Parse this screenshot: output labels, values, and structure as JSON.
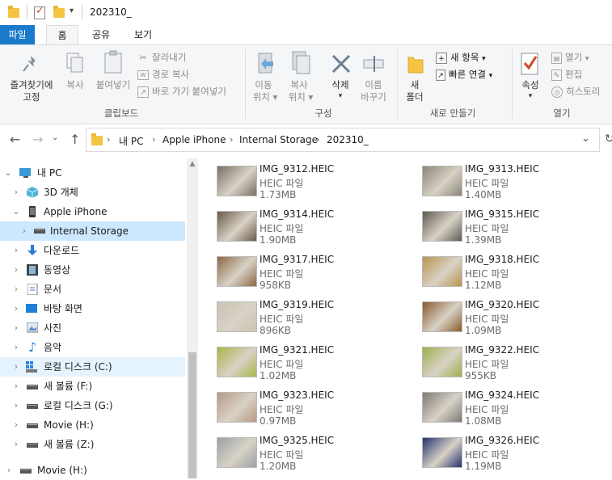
{
  "window": {
    "title": "202310_"
  },
  "tabs": {
    "file": "파일",
    "home": "홈",
    "share": "공유",
    "view": "보기"
  },
  "ribbon": {
    "clipboard": {
      "pin_quick": [
        "즐겨찾기에",
        "고정"
      ],
      "copy": "복사",
      "paste": "붙여넣기",
      "cut": "잘라내기",
      "copy_path": "경로 복사",
      "paste_shortcut": "바로 가기 붙여넣기",
      "group": "클립보드"
    },
    "organize": {
      "move_to": [
        "이동",
        "위치"
      ],
      "copy_to": [
        "복사",
        "위치"
      ],
      "delete": "삭제",
      "rename": [
        "이름",
        "바꾸기"
      ],
      "group": "구성"
    },
    "new": {
      "new_folder": [
        "새",
        "폴더"
      ],
      "new_item": "새 항목",
      "easy_access": "빠른 연결",
      "group": "새로 만들기"
    },
    "open": {
      "properties": "속성",
      "open": "열기",
      "edit": "편집",
      "history": "히스토리",
      "group": "열기"
    }
  },
  "address": {
    "crumbs": [
      "내 PC",
      "Apple iPhone",
      "Internal Storage",
      "202310_"
    ]
  },
  "nav": {
    "items": [
      {
        "label": "내 PC",
        "icon": "pc-icon",
        "chev": "⌄"
      },
      {
        "label": "3D 개체",
        "icon": "cube-icon",
        "chev": "›"
      },
      {
        "label": "Apple iPhone",
        "icon": "phone-icon",
        "chev": "⌄"
      },
      {
        "label": "Internal Storage",
        "icon": "drive-icon",
        "chev": "›"
      },
      {
        "label": "다운로드",
        "icon": "download-icon",
        "chev": "›"
      },
      {
        "label": "동영상",
        "icon": "video-icon",
        "chev": "›"
      },
      {
        "label": "문서",
        "icon": "document-icon",
        "chev": "›"
      },
      {
        "label": "바탕 화면",
        "icon": "desktop-icon",
        "chev": "›"
      },
      {
        "label": "사진",
        "icon": "picture-icon",
        "chev": "›"
      },
      {
        "label": "음악",
        "icon": "music-icon",
        "chev": "›"
      },
      {
        "label": "로컬 디스크 (C:)",
        "icon": "windows-drive-icon",
        "chev": "›"
      },
      {
        "label": "새 볼륨 (F:)",
        "icon": "drive-icon",
        "chev": "›"
      },
      {
        "label": "로컬 디스크 (G:)",
        "icon": "drive-icon",
        "chev": "›"
      },
      {
        "label": "Movie (H:)",
        "icon": "drive-icon",
        "chev": "›"
      },
      {
        "label": "새 볼륨 (Z:)",
        "icon": "drive-icon",
        "chev": "›"
      },
      {
        "label": "Movie (H:)",
        "icon": "drive-icon",
        "chev": "›"
      }
    ]
  },
  "files": [
    {
      "name": "IMG_9312.HEIC",
      "type": "HEIC 파일",
      "size": "1.73MB",
      "color": "#7a6f62"
    },
    {
      "name": "IMG_9313.HEIC",
      "type": "HEIC 파일",
      "size": "1.40MB",
      "color": "#8a8576"
    },
    {
      "name": "IMG_9314.HEIC",
      "type": "HEIC 파일",
      "size": "1.90MB",
      "color": "#6b5a49"
    },
    {
      "name": "IMG_9315.HEIC",
      "type": "HEIC 파일",
      "size": "1.39MB",
      "color": "#5e5a52"
    },
    {
      "name": "IMG_9317.HEIC",
      "type": "HEIC 파일",
      "size": "958KB",
      "color": "#8c6a45"
    },
    {
      "name": "IMG_9318.HEIC",
      "type": "HEIC 파일",
      "size": "1.12MB",
      "color": "#b9934f"
    },
    {
      "name": "IMG_9319.HEIC",
      "type": "HEIC 파일",
      "size": "896KB",
      "color": "#c9c4b4"
    },
    {
      "name": "IMG_9320.HEIC",
      "type": "HEIC 파일",
      "size": "1.09MB",
      "color": "#8a5a2e"
    },
    {
      "name": "IMG_9321.HEIC",
      "type": "HEIC 파일",
      "size": "1.02MB",
      "color": "#a9b54a"
    },
    {
      "name": "IMG_9322.HEIC",
      "type": "HEIC 파일",
      "size": "955KB",
      "color": "#9fae4d"
    },
    {
      "name": "IMG_9323.HEIC",
      "type": "HEIC 파일",
      "size": "0.97MB",
      "color": "#b79a86"
    },
    {
      "name": "IMG_9324.HEIC",
      "type": "HEIC 파일",
      "size": "1.08MB",
      "color": "#7d7a74"
    },
    {
      "name": "IMG_9325.HEIC",
      "type": "HEIC 파일",
      "size": "1.20MB",
      "color": "#9ca0a3"
    },
    {
      "name": "IMG_9326.HEIC",
      "type": "HEIC 파일",
      "size": "1.19MB",
      "color": "#25326e"
    }
  ],
  "colors": {
    "accent": "#1979ca",
    "selected": "#cce8ff"
  }
}
